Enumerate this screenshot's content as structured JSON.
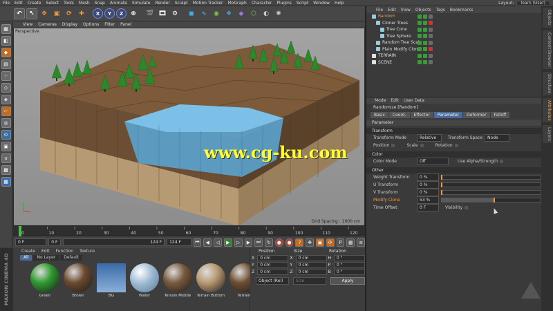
{
  "menubar": {
    "items": [
      "File",
      "Edit",
      "Create",
      "Select",
      "Tools",
      "Mesh",
      "Snap",
      "Animate",
      "Simulate",
      "Render",
      "Sculpt",
      "Motion Tracker",
      "MoGraph",
      "Character",
      "Plugins",
      "Script",
      "Window",
      "Help"
    ],
    "layout_label": "Layout:",
    "layout_value": "learn (User)"
  },
  "toolbar": {
    "axis_x": "X",
    "axis_y": "Y",
    "axis_z": "Z"
  },
  "viewport": {
    "menu": [
      "View",
      "Cameras",
      "Display",
      "Options",
      "Filter",
      "Panel"
    ],
    "label": "Perspective",
    "grid_spacing": "Grid Spacing : 1000 cm",
    "watermark": "www.cg-ku.com"
  },
  "timeline": {
    "ticks": [
      "0",
      "10",
      "20",
      "30",
      "40",
      "50",
      "60",
      "70",
      "80",
      "90",
      "100",
      "110",
      "120"
    ],
    "current_frame": "0 F",
    "start_frame": "0 F",
    "end_frame": "124 F",
    "end_frame2": "124 F",
    "playhead_fraction": 0.0
  },
  "material": {
    "menu": [
      "Create",
      "Edit",
      "Function",
      "Texture"
    ],
    "filters": [
      "All",
      "No Layer",
      "Default"
    ],
    "items": [
      {
        "name": "Green",
        "color": "#2f9a2f"
      },
      {
        "name": "Brown",
        "color": "#6a4a2e"
      },
      {
        "name": "BG",
        "color": "#4a7ab8"
      },
      {
        "name": "Water",
        "color": "#9ab8d0"
      },
      {
        "name": "Terrain Middle",
        "color": "#7a5a3e"
      },
      {
        "name": "Terrain Bottom",
        "color": "#b89a72"
      },
      {
        "name": "Terrain",
        "color": "#6e4e32"
      }
    ],
    "brand": "MAXON CINEMA 4D"
  },
  "coords": {
    "head": [
      "Position",
      "Size",
      "Rotation"
    ],
    "rows": [
      {
        "axis": "X",
        "pos": "0 cm",
        "size": "0 cm",
        "rot_axis": "H",
        "rot": "0 °"
      },
      {
        "axis": "Y",
        "pos": "0 cm",
        "size": "0 cm",
        "rot_axis": "P",
        "rot": "0 °"
      },
      {
        "axis": "Z",
        "pos": "0 cm",
        "size": "0 cm",
        "rot_axis": "B",
        "rot": "0 °"
      }
    ],
    "mode": "Object (Rel)",
    "size_mode": "Size",
    "apply": "Apply"
  },
  "objects": {
    "menu": [
      "File",
      "Edit",
      "View",
      "Objects",
      "Tags",
      "Bookmarks"
    ],
    "items": [
      {
        "name": "Random",
        "selected": true
      },
      {
        "name": "Cloner Trees",
        "selected": false
      },
      {
        "name": "Tree Cone",
        "selected": false
      },
      {
        "name": "Tree Sphere",
        "selected": false
      },
      {
        "name": "Random Tree Scale",
        "selected": false
      },
      {
        "name": "Plain Modify Clone",
        "selected": false
      },
      {
        "name": "TERRAIN",
        "selected": false
      },
      {
        "name": "SCENE",
        "selected": false
      }
    ]
  },
  "attributes": {
    "menu": [
      "Mode",
      "Edit",
      "User Data"
    ],
    "title": "Randomize [Random]",
    "tabs": [
      "Basic",
      "Coord.",
      "Effector",
      "Parameter",
      "Deformer",
      "Falloff"
    ],
    "active_tab": "Parameter",
    "section_parameter": "Parameter",
    "section_transform": "Transform",
    "transform_mode_label": "Transform Mode",
    "transform_mode_value": "Relative",
    "transform_space_label": "Transform Space",
    "transform_space_value": "Node",
    "position_label": "Position",
    "scale_label": "Scale",
    "rotation_label": "Rotation",
    "section_color": "Color",
    "color_mode_label": "Color Mode",
    "color_mode_value": "Off",
    "use_alpha_label": "Use Alpha/Strength",
    "section_other": "Other",
    "weight_label": "Weight Transform",
    "weight_value": "0 %",
    "weight_fraction": 0.0,
    "u_label": "U Transform",
    "u_value": "0 %",
    "u_fraction": 0.0,
    "v_label": "V Transform",
    "v_value": "0 %",
    "v_fraction": 0.0,
    "modify_label": "Modify Clone",
    "modify_value": "53 %",
    "modify_fraction": 0.53,
    "time_offset_label": "Time Offset",
    "time_offset_value": "0 F",
    "visibility_label": "Visibility"
  },
  "sidestrip": [
    "Objects",
    "Content Browser",
    "Structure",
    "Attributes",
    "Layers"
  ]
}
